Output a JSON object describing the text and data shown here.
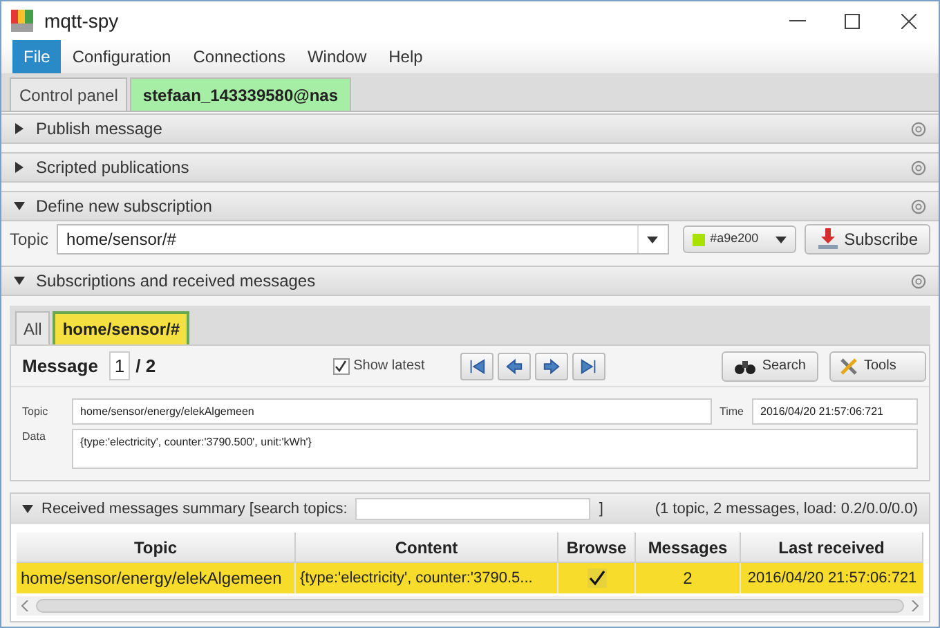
{
  "window": {
    "title": "mqtt-spy"
  },
  "menu": [
    {
      "label": "File",
      "selected": true
    },
    {
      "label": "Configuration",
      "selected": false
    },
    {
      "label": "Connections",
      "selected": false
    },
    {
      "label": "Window",
      "selected": false
    },
    {
      "label": "Help",
      "selected": false
    }
  ],
  "connection_tabs": [
    {
      "label": "Control panel",
      "selected": false
    },
    {
      "label": "stefaan_143339580@nas",
      "selected": true
    }
  ],
  "sections": [
    {
      "title": "Publish message",
      "expanded": false
    },
    {
      "title": "Scripted publications",
      "expanded": false
    },
    {
      "title": "Define new subscription",
      "expanded": true
    },
    {
      "title": "Subscriptions and received messages",
      "expanded": true
    }
  ],
  "new_subscription": {
    "topic_label": "Topic",
    "topic": "home/sensor/#",
    "color": "#a9e200",
    "color_label": "#a9e200",
    "subscribe_button": "Subscribe"
  },
  "subscription_tabs": [
    {
      "label": "All",
      "selected": false
    },
    {
      "label": "home/sensor/#",
      "selected": true,
      "color": "#f5e042"
    }
  ],
  "message": {
    "label": "Message",
    "index": "1",
    "total": "/ 2",
    "show_latest": {
      "label": "Show latest",
      "checked": true
    },
    "search_button": "Search",
    "tools_button": "Tools",
    "topic_label": "Topic",
    "topic": "home/sensor/energy/elekAlgemeen",
    "time_label": "Time",
    "time": "2016/04/20 21:57:06:721",
    "data_label": "Data",
    "data": "{type:'electricity', counter:'3790.500', unit:'kWh'}"
  },
  "summary": {
    "title": "Received messages summary [search topics:",
    "close_bracket": "]",
    "stats": "(1 topic, 2 messages, load: 0.2/0.0/0.0)",
    "expanded": true
  },
  "table": {
    "columns": [
      "Topic",
      "Content",
      "Browse",
      "Messages",
      "Last received"
    ],
    "rows": [
      {
        "topic": "home/sensor/energy/elekAlgemeen",
        "content": "{type:'electricity', counter:'3790.5...",
        "browse": true,
        "messages": "2",
        "last_received": "2016/04/20 21:57:06:721",
        "selected": true
      }
    ]
  }
}
